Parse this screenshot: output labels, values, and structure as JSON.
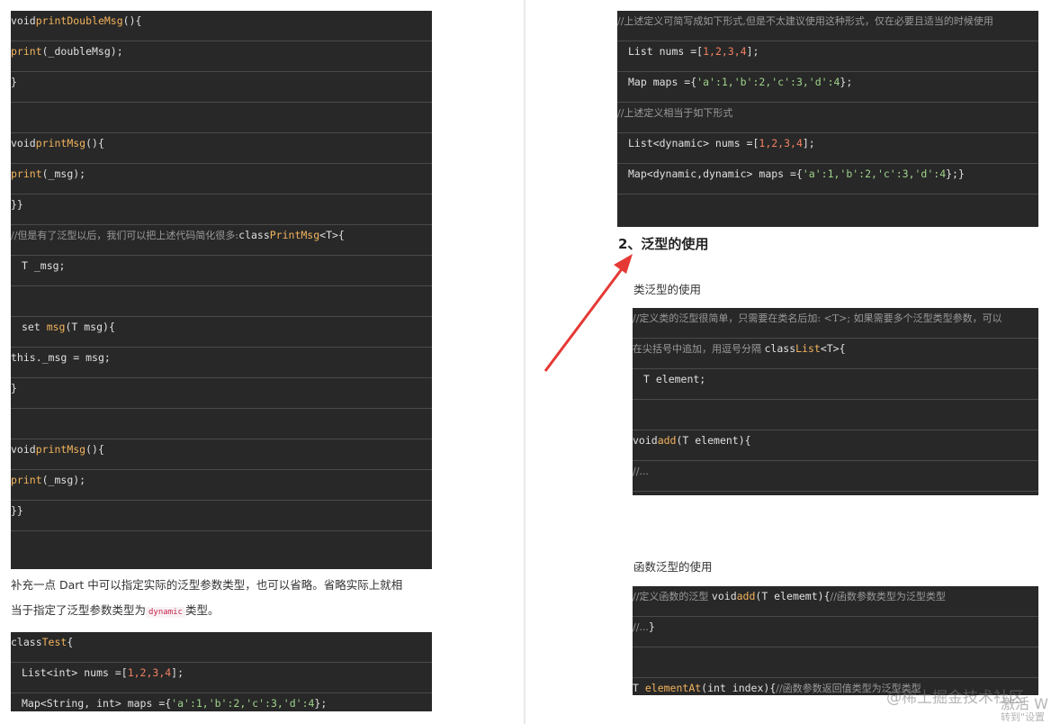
{
  "left": {
    "block1": [
      {
        "t": "void",
        "f": "printDoubleMsg",
        "r": "(){"
      },
      {
        "f": "print",
        "r": "(_doubleMsg);"
      },
      {
        "r": "}"
      },
      {
        "r": ""
      },
      {
        "t": "void",
        "f": "printMsg",
        "r": "(){"
      },
      {
        "f": "print",
        "r": "(_msg);"
      },
      {
        "r": "}}"
      },
      {
        "c": "//但是有了泛型以后，我们可以把上述代码简化很多:",
        "t": "class",
        "cl": "PrintMsg",
        "r": "<T>{"
      },
      {
        "i": true,
        "r": "T _msg;"
      },
      {
        "r": ""
      },
      {
        "i": true,
        "pre": "set ",
        "f": "msg",
        "r": "(T msg){"
      },
      {
        "t": "this",
        "r": "._msg = msg;"
      },
      {
        "r": "}"
      },
      {
        "r": ""
      },
      {
        "t": "void",
        "f": "printMsg",
        "r": "(){"
      },
      {
        "f": "print",
        "r": "(_msg);"
      },
      {
        "r": "}}"
      },
      {
        "r": ""
      }
    ],
    "para_line1": "补充一点 Dart 中可以指定实际的泛型参数类型，也可以省略。省略实际上就相",
    "para_line2_a": "当于指定了泛型参数类型为",
    "para_code": "dynamic",
    "para_line2_b": "类型。",
    "block2": [
      {
        "t": "class",
        "cl": "Test",
        "r": "{"
      },
      {
        "i": true,
        "r": "List<int> nums =[",
        "n": "1,2,3,4",
        "e": "];"
      },
      {
        "i": true,
        "r": "Map<String, int> maps ={",
        "s": "'a':1,'b':2,'c':3,'d':4",
        "e": "};"
      }
    ]
  },
  "right": {
    "block1": [
      {
        "c": "//上述定义可简写成如下形式,但是不太建议使用这种形式，仅在必要且适当的时候使用"
      },
      {
        "i": true,
        "r": "List nums =[",
        "n": "1,2,3,4",
        "e": "];"
      },
      {
        "i": true,
        "r": "Map maps ={",
        "s": "'a':1,'b':2,'c':3,'d':4",
        "e": "};"
      },
      {
        "c": "//上述定义相当于如下形式"
      },
      {
        "i": true,
        "r": "List<dynamic> nums =[",
        "n": "1,2,3,4",
        "e": "];"
      },
      {
        "i": true,
        "r": "Map<dynamic,dynamic> maps ={",
        "s": "'a':1,'b':2,'c':3,'d':4",
        "e": "};}"
      },
      {
        "r": ""
      }
    ],
    "heading": "2、泛型的使用",
    "sub1": "类泛型的使用",
    "block2": [
      {
        "c": "//定义类的泛型很简单，只需要在类名后加: <T>; 如果需要多个泛型类型参数，可以"
      },
      {
        "c": "在尖括号中追加，用逗号分隔 ",
        "t": "class",
        "cl": "List",
        "r": "<T>{"
      },
      {
        "i": true,
        "r": "T element;"
      },
      {
        "r": ""
      },
      {
        "t": "void",
        "f": "add",
        "r": "(T element){"
      },
      {
        "c": "//..."
      },
      {
        "r": "}}"
      }
    ],
    "sub2": "函数泛型的使用",
    "block3": [
      {
        "c": "//定义函数的泛型 ",
        "t": "void",
        "f": "add",
        "r": "(T elememt){",
        "c2": "//函数参数类型为泛型类型"
      },
      {
        "c": "//...",
        "r": "}"
      },
      {
        "r": ""
      },
      {
        "r": "T ",
        "f": "elementAt",
        "r2": "(int index){",
        "c2": "//函数参数返回值类型为泛型类型"
      }
    ]
  },
  "watermark": "@稀土掘金技术社区",
  "watermark2": "激活 W",
  "watermark3": "转到\"设置",
  "colors": {
    "code_bg": "#282828",
    "arrow": "#e53935"
  }
}
